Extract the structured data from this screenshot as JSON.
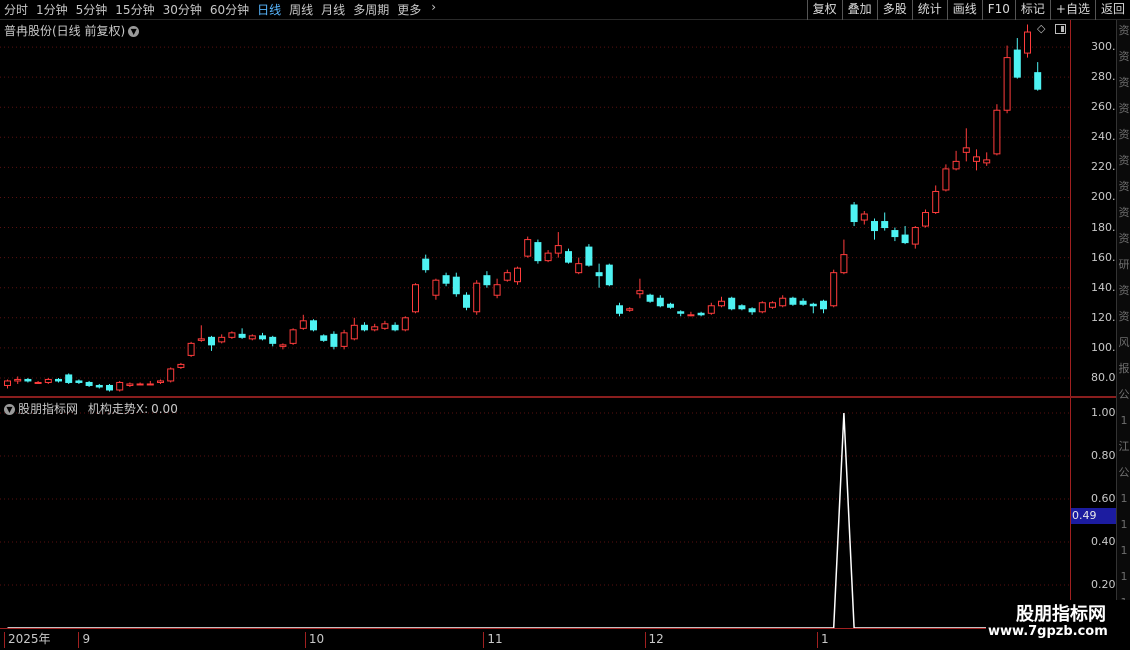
{
  "toolbar": {
    "period_tabs": [
      "分时",
      "1分钟",
      "5分钟",
      "15分钟",
      "30分钟",
      "60分钟",
      "日线",
      "周线",
      "月线",
      "多周期",
      "更多"
    ],
    "active_tab": "日线",
    "more_icon": "chevron-right-icon",
    "buttons": [
      "复权",
      "叠加",
      "多股",
      "统计",
      "画线",
      "F10",
      "标记",
      "+自选",
      "返回"
    ]
  },
  "main_panel": {
    "stock_title": "普冉股份(日线 前复权)",
    "dropdown_icon": "circle-chevron-down-icon",
    "diamond_icon": "diamond-icon",
    "toggle_icon": "panel-toggle-icon"
  },
  "indicator_panel": {
    "source_label": "股朋指标网",
    "indicator_name": "机构走势X:",
    "indicator_value": "0.00",
    "cursor_value": "0.49"
  },
  "colors": {
    "up": "#ff3c3c",
    "down": "#4ef2f2",
    "grid": "#5a1010",
    "axis": "#a02020",
    "cursor_bg": "#1c1ca0"
  },
  "right_strip_glyphs": [
    "资",
    "资",
    "资",
    "资",
    "资",
    "资",
    "资",
    "资",
    "资",
    "研",
    "资",
    "资",
    "风",
    "报",
    "公",
    "1",
    "江",
    "公",
    "1",
    "1",
    "1",
    "1",
    "1"
  ],
  "chart_data": [
    {
      "type": "candlestick",
      "title": "普冉股份(日线 前复权)",
      "ylim": [
        68,
        318
      ],
      "yticks": [
        80,
        100,
        120,
        140,
        160,
        180,
        200,
        220,
        240,
        260,
        280,
        300
      ],
      "ytick_labels": [
        "80.00",
        "100.00",
        "120.00",
        "140.00",
        "160.00",
        "180.00",
        "200.00",
        "220.00",
        "240.00",
        "260.00",
        "280.00",
        "300.00"
      ],
      "date_labels": [
        "2025年",
        "9",
        "10",
        "11",
        "12",
        "1"
      ],
      "candles": [
        [
          75,
          78,
          73,
          79
        ],
        [
          78,
          79,
          76,
          81
        ],
        [
          79,
          78,
          77,
          80
        ],
        [
          77,
          77,
          76,
          78
        ],
        [
          77,
          79,
          76,
          80
        ],
        [
          79,
          78,
          77,
          80
        ],
        [
          82,
          77,
          76,
          83
        ],
        [
          78,
          77,
          76,
          79
        ],
        [
          77,
          75,
          74,
          78
        ],
        [
          75,
          74,
          73,
          76
        ],
        [
          75,
          72,
          71,
          76
        ],
        [
          72,
          77,
          71,
          78
        ],
        [
          75,
          76,
          74,
          77
        ],
        [
          76,
          76,
          75,
          77
        ],
        [
          76,
          76,
          75,
          78
        ],
        [
          77,
          78,
          76,
          79
        ],
        [
          78,
          86,
          77,
          87
        ],
        [
          87,
          89,
          86,
          90
        ],
        [
          95,
          103,
          94,
          104
        ],
        [
          105,
          106,
          104,
          115
        ],
        [
          107,
          102,
          98,
          108
        ],
        [
          104,
          107,
          103,
          109
        ],
        [
          107,
          110,
          106,
          111
        ],
        [
          109,
          107,
          106,
          113
        ],
        [
          106,
          108,
          105,
          109
        ],
        [
          108,
          106,
          105,
          110
        ],
        [
          107,
          103,
          101,
          108
        ],
        [
          101,
          102,
          99,
          103
        ],
        [
          103,
          112,
          102,
          113
        ],
        [
          113,
          118,
          112,
          122
        ],
        [
          118,
          112,
          111,
          119
        ],
        [
          108,
          105,
          104,
          109
        ],
        [
          109,
          101,
          99,
          111
        ],
        [
          101,
          110,
          99,
          112
        ],
        [
          106,
          115,
          105,
          120
        ],
        [
          115,
          112,
          111,
          117
        ],
        [
          112,
          114,
          111,
          116
        ],
        [
          113,
          116,
          112,
          118
        ],
        [
          115,
          112,
          111,
          117
        ],
        [
          112,
          120,
          111,
          121
        ],
        [
          124,
          142,
          123,
          143
        ],
        [
          159,
          152,
          150,
          162
        ],
        [
          135,
          145,
          132,
          146
        ],
        [
          148,
          143,
          141,
          150
        ],
        [
          147,
          136,
          134,
          150
        ],
        [
          135,
          127,
          125,
          137
        ],
        [
          124,
          143,
          122,
          145
        ],
        [
          148,
          142,
          140,
          151
        ],
        [
          135,
          142,
          133,
          146
        ],
        [
          145,
          150,
          144,
          152
        ],
        [
          144,
          153,
          142,
          154
        ],
        [
          161,
          172,
          160,
          174
        ],
        [
          170,
          158,
          156,
          172
        ],
        [
          158,
          163,
          157,
          165
        ],
        [
          163,
          168,
          160,
          177
        ],
        [
          164,
          157,
          156,
          166
        ],
        [
          150,
          156,
          149,
          160
        ],
        [
          167,
          155,
          154,
          169
        ],
        [
          150,
          148,
          140,
          156
        ],
        [
          155,
          142,
          141,
          156
        ],
        [
          128,
          123,
          121,
          130
        ],
        [
          125,
          126,
          124,
          127
        ],
        [
          136,
          138,
          133,
          146
        ],
        [
          135,
          131,
          130,
          136
        ],
        [
          133,
          128,
          127,
          135
        ],
        [
          129,
          127,
          126,
          130
        ],
        [
          124,
          123,
          121,
          125
        ],
        [
          122,
          122,
          121,
          124
        ],
        [
          123,
          122,
          121,
          124
        ],
        [
          123,
          128,
          122,
          130
        ],
        [
          128,
          131,
          127,
          134
        ],
        [
          133,
          126,
          125,
          134
        ],
        [
          128,
          126,
          125,
          129
        ],
        [
          126,
          124,
          122,
          127
        ],
        [
          124,
          130,
          123,
          131
        ],
        [
          127,
          130,
          126,
          131
        ],
        [
          128,
          133,
          127,
          135
        ],
        [
          133,
          129,
          128,
          134
        ],
        [
          131,
          129,
          128,
          133
        ],
        [
          129,
          128,
          123,
          130
        ],
        [
          131,
          126,
          123,
          132
        ],
        [
          128,
          150,
          127,
          152
        ],
        [
          150,
          162,
          149,
          172
        ],
        [
          195,
          184,
          181,
          197
        ],
        [
          185,
          189,
          182,
          191
        ],
        [
          184,
          178,
          172,
          186
        ],
        [
          184,
          180,
          178,
          190
        ],
        [
          178,
          174,
          171,
          180
        ],
        [
          175,
          170,
          169,
          181
        ],
        [
          169,
          180,
          166,
          181
        ],
        [
          181,
          190,
          180,
          192
        ],
        [
          190,
          204,
          189,
          208
        ],
        [
          205,
          219,
          204,
          222
        ],
        [
          219,
          224,
          218,
          231
        ],
        [
          230,
          233,
          224,
          246
        ],
        [
          224,
          227,
          218,
          232
        ],
        [
          223,
          225,
          221,
          230
        ],
        [
          229,
          258,
          228,
          262
        ],
        [
          258,
          293,
          256,
          301
        ],
        [
          298,
          280,
          279,
          306
        ],
        [
          296,
          310,
          293,
          315
        ],
        [
          283,
          272,
          271,
          290
        ]
      ]
    },
    {
      "type": "line",
      "title": "机构走势X",
      "ylim": [
        0,
        1.07
      ],
      "yticks": [
        0.2,
        0.4,
        0.6,
        0.8,
        1.0
      ],
      "ytick_labels": [
        "0.20",
        "0.40",
        "0.60",
        "0.80",
        "1.00"
      ],
      "series": [
        {
          "name": "机构走势X",
          "values": [
            0,
            0,
            0,
            0,
            0,
            0,
            0,
            0,
            0,
            0,
            0,
            0,
            0,
            0,
            0,
            0,
            0,
            0,
            0,
            0,
            0,
            0,
            0,
            0,
            0,
            0,
            0,
            0,
            0,
            0,
            0,
            0,
            0,
            0,
            0,
            0,
            0,
            0,
            0,
            0,
            0,
            0,
            0,
            0,
            0,
            0,
            0,
            0,
            0,
            0,
            0,
            0,
            0,
            0,
            0,
            0,
            0,
            0,
            0,
            0,
            0,
            0,
            0,
            0,
            0,
            0,
            0,
            0,
            0,
            0,
            0,
            0,
            0,
            0,
            0,
            0,
            0,
            0,
            0,
            0,
            0,
            0,
            1,
            0,
            0,
            0,
            0,
            0,
            0,
            0,
            0,
            0,
            0,
            0,
            0,
            0,
            0,
            0,
            0,
            0,
            0,
            0
          ]
        }
      ]
    }
  ]
}
